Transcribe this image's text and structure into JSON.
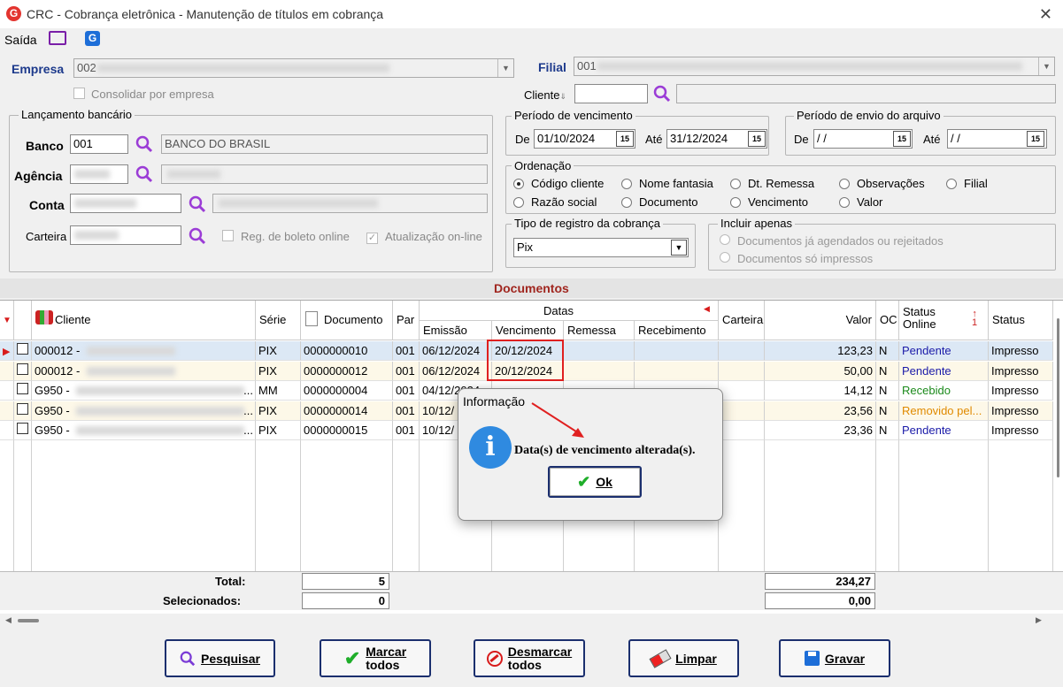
{
  "window": {
    "title": "CRC - Cobrança eletrônica - Manutenção de títulos em cobrança"
  },
  "menu": {
    "exit": "Saída"
  },
  "empresa": {
    "label": "Empresa",
    "value": "002",
    "consolidar": "Consolidar por empresa"
  },
  "filial": {
    "label": "Filial",
    "value": "001"
  },
  "cliente": {
    "label": "Cliente"
  },
  "lancamento": {
    "title": "Lançamento bancário",
    "banco_label": "Banco",
    "banco_value": "001",
    "banco_name": "BANCO DO BRASIL",
    "agencia_label": "Agência",
    "conta_label": "Conta",
    "carteira_label": "Carteira",
    "reg_boleto": "Reg. de boleto online",
    "atualizacao": "Atualização on-line"
  },
  "vencimento": {
    "title": "Período de vencimento",
    "de_label": "De",
    "de": "01/10/2024",
    "ate_label": "Até",
    "ate": "31/12/2024"
  },
  "envio": {
    "title": "Período de envio do arquivo",
    "de_label": "De",
    "de": " / /",
    "ate_label": "Até",
    "ate": " / /"
  },
  "ordenacao": {
    "title": "Ordenação",
    "options": [
      "Código cliente",
      "Nome fantasia",
      "Dt. Remessa",
      "Observações",
      "Filial",
      "Razão social",
      "Documento",
      "Vencimento",
      "Valor"
    ],
    "selected": "Código cliente"
  },
  "tipo_registro": {
    "title": "Tipo de registro da cobrança",
    "value": "Pix"
  },
  "incluir": {
    "title": "Incluir apenas",
    "options": [
      "Documentos já agendados ou rejeitados",
      "Documentos só impressos"
    ]
  },
  "documentos": {
    "title": "Documentos"
  },
  "grid": {
    "headers": {
      "cliente": "Cliente",
      "serie": "Série",
      "documento": "Documento",
      "par": "Par",
      "datas": "Datas",
      "emissao": "Emissão",
      "vencimento": "Vencimento",
      "remessa": "Remessa",
      "recebimento": "Recebimento",
      "carteira": "Carteira",
      "valor": "Valor",
      "oc": "OC",
      "status_online": "Status Online",
      "status": "Status"
    },
    "rows": [
      {
        "cliente": "000012 -",
        "serie": "PIX",
        "documento": "0000000010",
        "par": "001",
        "emissao": "06/12/2024",
        "vencimento": "20/12/2024",
        "valor": "123,23",
        "oc": "N",
        "status_online": "Pendente",
        "status": "Impresso"
      },
      {
        "cliente": "000012 -",
        "serie": "PIX",
        "documento": "0000000012",
        "par": "001",
        "emissao": "06/12/2024",
        "vencimento": "20/12/2024",
        "valor": "50,00",
        "oc": "N",
        "status_online": "Pendente",
        "status": "Impresso"
      },
      {
        "cliente": "G950 -",
        "serie": "MM",
        "documento": "0000000004",
        "par": "001",
        "emissao": "04/12/2024",
        "vencimento": "",
        "valor": "14,12",
        "oc": "N",
        "status_online": "Recebido",
        "status": "Impresso"
      },
      {
        "cliente": "G950 -",
        "serie": "PIX",
        "documento": "0000000014",
        "par": "001",
        "emissao": "10/12/",
        "vencimento": "",
        "valor": "23,56",
        "oc": "N",
        "status_online": "Removido pel...",
        "status": "Impresso"
      },
      {
        "cliente": "G950 -",
        "serie": "PIX",
        "documento": "0000000015",
        "par": "001",
        "emissao": "10/12/",
        "vencimento": "",
        "valor": "23,36",
        "oc": "N",
        "status_online": "Pendente",
        "status": "Impresso"
      }
    ],
    "total_label": "Total:",
    "total_count": "5",
    "total_value": "234,27",
    "selecionados_label": "Selecionados:",
    "selecionados_count": "0",
    "selecionados_value": "0,00"
  },
  "status_colors": {
    "Pendente": "#1a1aa8",
    "Recebido": "#1b8a1b",
    "Removido pel...": "#e08a00"
  },
  "dialog": {
    "title": "Informação",
    "message": "Data(s) de vencimento alterada(s).",
    "ok": "Ok"
  },
  "buttons": {
    "pesquisar": "Pesquisar",
    "marcar_1": "Marcar",
    "marcar_2": "todos",
    "desmarcar_1": "Desmarcar",
    "desmarcar_2": "todos",
    "limpar": "Limpar",
    "gravar": "Gravar"
  },
  "colors": {
    "accent": "#1d3a8c",
    "section_title": "#a0261f",
    "highlight": "#e02020"
  }
}
